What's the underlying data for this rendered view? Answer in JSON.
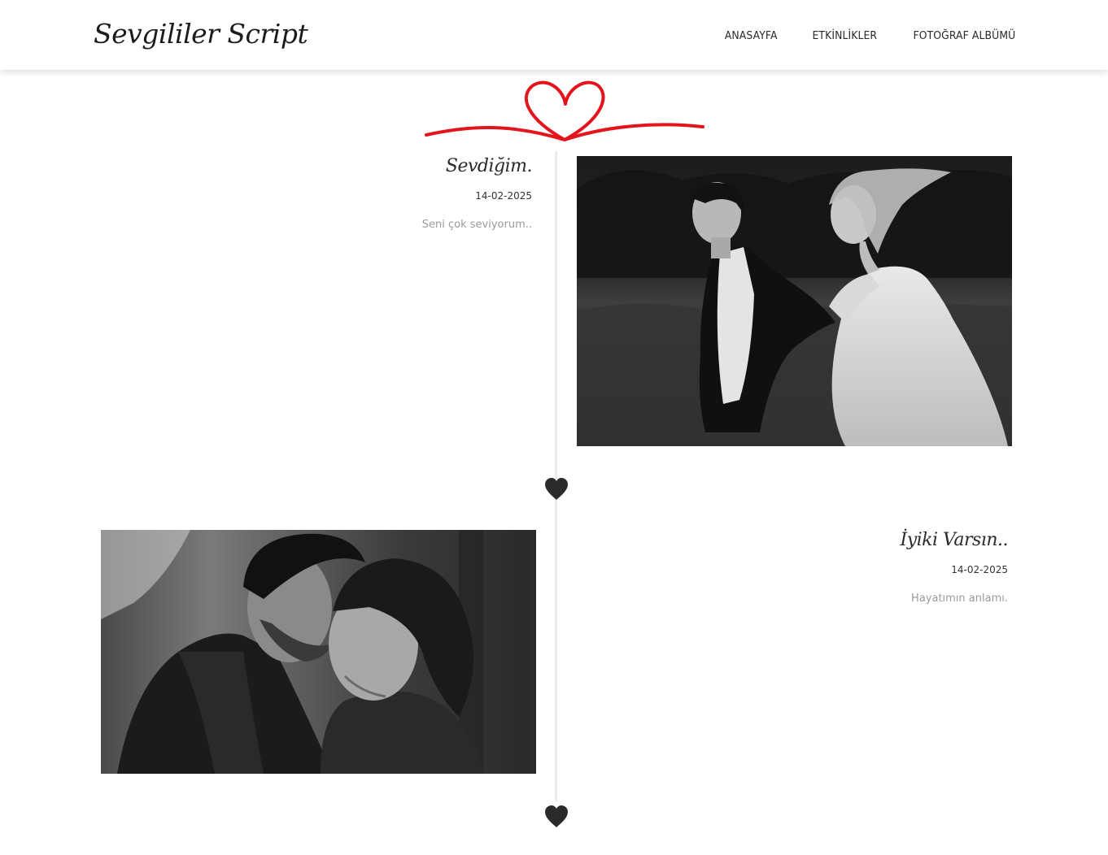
{
  "brand": {
    "name": "Sevgililer Script"
  },
  "nav": {
    "items": [
      "ANASAYFA",
      "ETKİNLİKLER",
      "FOTOĞRAF ALBÜMÜ"
    ]
  },
  "timeline": {
    "entries": [
      {
        "title": "Sevdiğim.",
        "date": "14-02-2025",
        "description": "Seni çok seviyorum.."
      },
      {
        "title": "İyiki Varsın..",
        "date": "14-02-2025",
        "description": "Hayatımın anlamı."
      }
    ]
  },
  "colors": {
    "accent": "#e3141b",
    "marker": "#2b2b2b",
    "line": "#ececec"
  },
  "icons": {
    "ribbon": "heart-ribbon-icon",
    "marker": "heart-icon"
  }
}
